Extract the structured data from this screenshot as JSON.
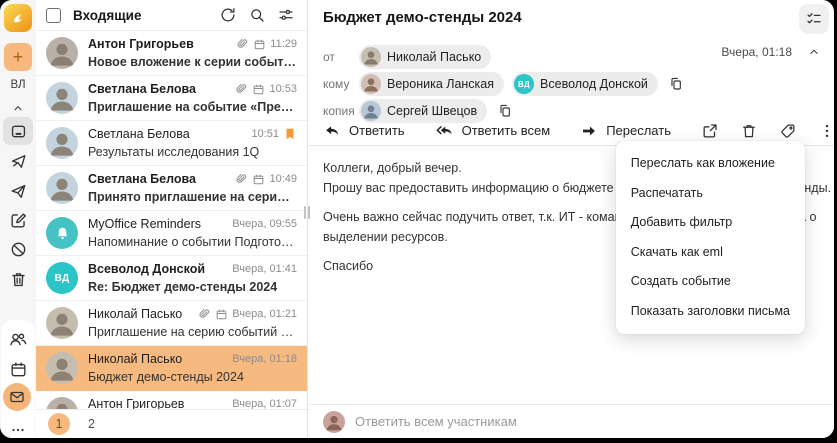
{
  "colors": {
    "accent": "#F6BA81",
    "flag": "#F59B30",
    "teal": "#2CC4C6",
    "rail_bg": "#F6F6F6"
  },
  "sidebar": {
    "plus_label": "+",
    "user_initials": "ВЛ",
    "folders": [
      "inbox",
      "outbox",
      "sent",
      "drafts",
      "spam",
      "trash"
    ],
    "apps": [
      "contacts",
      "calendar",
      "mail",
      "more"
    ]
  },
  "list": {
    "title": "Входящие",
    "pagination": [
      "1",
      "2"
    ],
    "emails": [
      {
        "sender": "Антон Григорьев",
        "subject": "Новое вложение к серии событий «Аналити...",
        "time": "11:29",
        "unread": true,
        "attachment": true,
        "event": true,
        "flagged": false,
        "selected": false,
        "avatar": {
          "type": "photo",
          "bg": "#b9b0a7"
        }
      },
      {
        "sender": "Светлана Белова",
        "subject": "Приглашение на событие «Предварительно...",
        "time": "10:53",
        "unread": true,
        "attachment": true,
        "event": true,
        "flagged": false,
        "selected": false,
        "avatar": {
          "type": "photo",
          "bg": "#c3d4de"
        }
      },
      {
        "sender": "Светлана Белова",
        "subject": "Результаты исследования 1Q",
        "time": "10:51",
        "unread": false,
        "attachment": false,
        "event": false,
        "flagged": true,
        "selected": false,
        "avatar": {
          "type": "photo",
          "bg": "#c3d4de"
        }
      },
      {
        "sender": "Светлана Белова",
        "subject": "Принято приглашение на серию событий «...",
        "time": "10:49",
        "unread": true,
        "attachment": true,
        "event": true,
        "flagged": false,
        "selected": false,
        "avatar": {
          "type": "photo",
          "bg": "#c3d4de"
        }
      },
      {
        "sender": "MyOffice Reminders",
        "subject": "Напоминание о событии Подготовить отчет...",
        "time": "Вчера, 09:55",
        "unread": false,
        "attachment": false,
        "event": false,
        "flagged": false,
        "selected": false,
        "avatar": {
          "type": "bell",
          "bg": "#45c2c4"
        }
      },
      {
        "sender": "Всеволод Донской",
        "subject": "Re: Бюджет демо-стенды 2024",
        "time": "Вчера, 01:41",
        "unread": true,
        "attachment": false,
        "event": false,
        "flagged": false,
        "selected": false,
        "avatar": {
          "type": "initials",
          "text": "ВД",
          "bg": "#2cc4c6"
        }
      },
      {
        "sender": "Николай Пасько",
        "subject": "Приглашение на серию событий «Демо стен...",
        "time": "Вчера, 01:21",
        "unread": false,
        "attachment": true,
        "event": true,
        "flagged": false,
        "selected": false,
        "avatar": {
          "type": "photo",
          "bg": "#c6bdb1"
        }
      },
      {
        "sender": "Николай Пасько",
        "subject": "Бюджет демо-стенды 2024",
        "time": "Вчера, 01:18",
        "unread": false,
        "attachment": false,
        "event": false,
        "flagged": false,
        "selected": true,
        "avatar": {
          "type": "photo",
          "bg": "#c6bdb1"
        }
      },
      {
        "sender": "Антон Григорьев",
        "subject": "",
        "time": "Вчера, 01:07",
        "unread": false,
        "attachment": false,
        "event": false,
        "flagged": false,
        "selected": false,
        "avatar": {
          "type": "photo",
          "bg": "#b9b0a7"
        }
      }
    ]
  },
  "message": {
    "subject": "Бюджет демо-стенды 2024",
    "date": "Вчера, 01:18",
    "labels": {
      "from": "от",
      "to": "кому",
      "cc": "копия"
    },
    "from": {
      "name": "Николай Пасько",
      "bg": "#c6bdb1"
    },
    "to": [
      {
        "name": "Вероника Ланская",
        "type": "photo",
        "bg": "#d2bfb4"
      },
      {
        "name": "Всеволод Донской",
        "type": "initials",
        "initials": "ВД",
        "bg": "#2cc4c6"
      }
    ],
    "cc": [
      {
        "name": "Сергей Швецов",
        "type": "photo",
        "bg": "#b9c6d6"
      }
    ],
    "toolbar": {
      "reply": "Ответить",
      "reply_all": "Ответить всем",
      "forward": "Переслать"
    },
    "body_lines": [
      "Коллеги, добрый вечер.",
      "Прошу вас предоставить информацию о бюджете на наши демонстрационные стенды.",
      "",
      "Очень важно сейчас подучить ответ, т.к. ИТ - команда Всеволода, уже спрашивала о",
      "выделении ресурсов.",
      "",
      "Спасибо"
    ],
    "reply_placeholder": "Ответить всем участникам"
  },
  "context_menu": {
    "items": [
      "Переслать как вложение",
      "Распечатать",
      "Добавить фильтр",
      "Скачать как eml",
      "Создать событие",
      "Показать заголовки письма"
    ]
  }
}
